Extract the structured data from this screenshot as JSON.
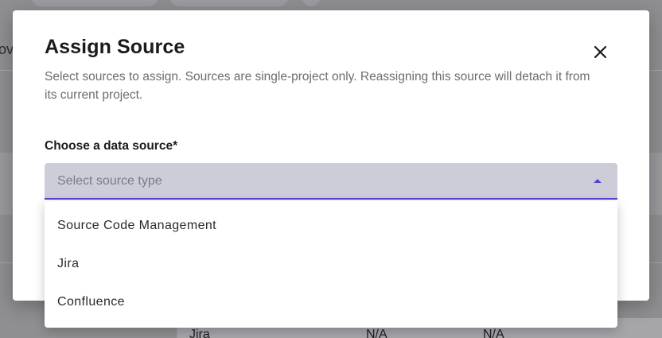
{
  "background": {
    "left_text": "ov",
    "table_row": {
      "cells": [
        "Jira",
        "N/A",
        "N/A"
      ]
    }
  },
  "modal": {
    "title": "Assign Source",
    "close_icon": "close-icon",
    "description": "Select sources to assign. Sources are single-project only. Reassigning this source will detach it from its current project.",
    "field": {
      "label": "Choose a data source*",
      "placeholder": "Select source type",
      "arrow_icon": "caret-up-icon"
    }
  },
  "dropdown": {
    "options": [
      {
        "label": "Source Code Management"
      },
      {
        "label": "Jira"
      },
      {
        "label": "Confluence"
      }
    ]
  },
  "colors": {
    "accent": "#5b3fd6",
    "overlay": "#8f8f92",
    "select_fill": "#cccdd8",
    "title": "#1b1b1f",
    "description": "#6c6c72"
  }
}
